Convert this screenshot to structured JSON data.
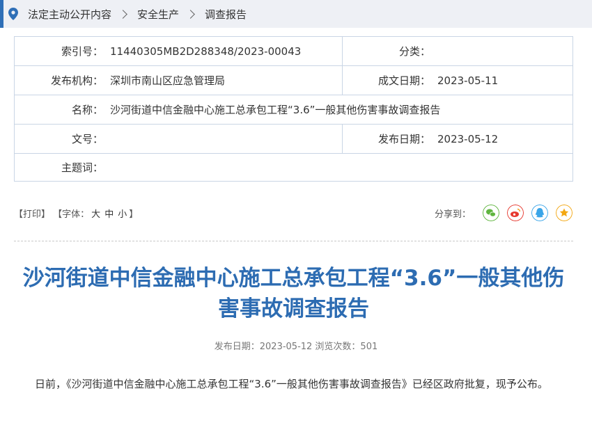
{
  "breadcrumb": {
    "items": [
      "法定主动公开内容",
      "安全生产",
      "调查报告"
    ]
  },
  "meta": {
    "index_label": "索引号：",
    "index_value": "11440305MB2D288348/2023-00043",
    "category_label": "分类：",
    "category_value": "",
    "publisher_label": "发布机构：",
    "publisher_value": "深圳市南山区应急管理局",
    "created_label": "成文日期：",
    "created_value": "2023-05-11",
    "name_label": "名称：",
    "name_value": "沙河街道中信金融中心施工总承包工程“3.6”一般其他伤害事故调查报告",
    "docno_label": "文号：",
    "docno_value": "",
    "published_label": "发布日期：",
    "published_value": "2023-05-12",
    "subject_label": "主题词：",
    "subject_value": ""
  },
  "tools": {
    "print": "【打印】",
    "font_prefix": "【字体：",
    "font_large": "大",
    "font_medium": "中",
    "font_small": "小",
    "font_suffix": "】"
  },
  "share": {
    "label": "分享到：",
    "icons": [
      "wechat-icon",
      "weibo-icon",
      "qq-icon",
      "qzone-icon"
    ],
    "colors": {
      "wechat": "#5fb53f",
      "weibo": "#e6392f",
      "qq": "#3aa5e8",
      "qzone": "#f3a712"
    }
  },
  "article": {
    "title": "沙河街道中信金融中心施工总承包工程“3.6”一般其他伤害事故调查报告",
    "pubinfo": "发布日期：2023-05-12  浏览次数：501",
    "body": "日前，《沙河街道中信金融中心施工总承包工程“3.6”一般其他伤害事故调查报告》已经区政府批复，现予公布。"
  },
  "colors": {
    "accent": "#2d6cb2",
    "border": "#c9d5e5",
    "crumb_bg": "#eef0f5"
  }
}
